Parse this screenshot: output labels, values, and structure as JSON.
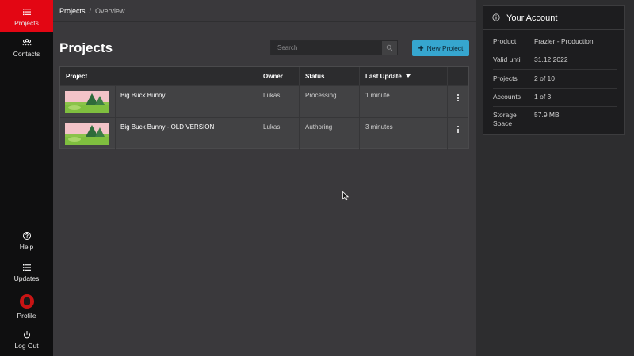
{
  "sidebar": {
    "top": [
      {
        "label": "Projects",
        "icon": "list-icon",
        "active": true
      },
      {
        "label": "Contacts",
        "icon": "users-icon",
        "active": false
      }
    ],
    "bottom": [
      {
        "label": "Help",
        "icon": "help-circle-icon"
      },
      {
        "label": "Updates",
        "icon": "list-icon"
      },
      {
        "label": "Profile",
        "icon": "avatar"
      },
      {
        "label": "Log Out",
        "icon": "power-icon"
      }
    ]
  },
  "breadcrumb": {
    "root": "Projects",
    "separator": "/",
    "current": "Overview"
  },
  "main": {
    "title": "Projects",
    "search_placeholder": "Search",
    "new_project_label": "New Project"
  },
  "table": {
    "columns": [
      "Project",
      "Owner",
      "Status",
      "Last Update"
    ],
    "sort_column": "Last Update",
    "rows": [
      {
        "name": "Big Buck Bunny",
        "owner": "Lukas",
        "status": "Processing",
        "last_update": "1 minute"
      },
      {
        "name": "Big Buck Bunny - OLD VERSION",
        "owner": "Lukas",
        "status": "Authoring",
        "last_update": "3 minutes"
      }
    ]
  },
  "account": {
    "title": "Your Account",
    "fields": [
      {
        "label": "Product",
        "value": "Frazier - Production"
      },
      {
        "label": "Valid until",
        "value": "31.12.2022"
      },
      {
        "label": "Projects",
        "value": "2 of 10"
      },
      {
        "label": "Accounts",
        "value": "1 of 3"
      },
      {
        "label": "Storage Space",
        "value": "57.9 MB"
      }
    ]
  },
  "colors": {
    "accent": "#e30613",
    "primary_button": "#36a6cf",
    "sidebar_bg": "#0f0f10",
    "main_bg": "#3a393c"
  }
}
